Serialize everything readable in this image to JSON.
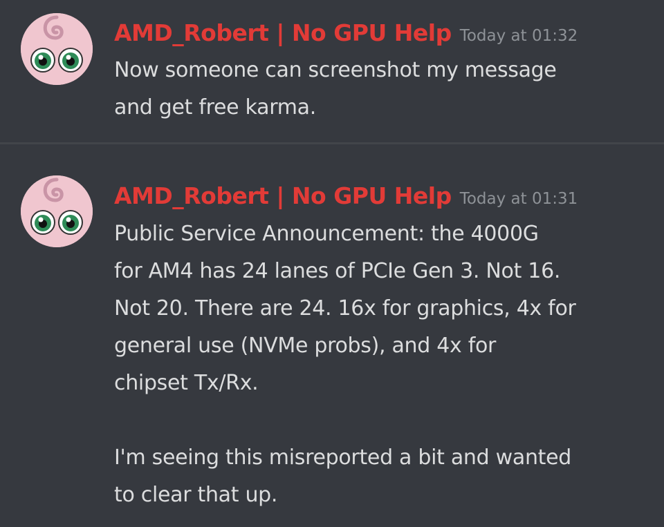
{
  "messages": [
    {
      "username": "AMD_Robert | No GPU Help",
      "timestamp": "Today at 01:32",
      "lines": [
        "Now someone can screenshot my message",
        "and get free karma."
      ]
    },
    {
      "username": "AMD_Robert | No GPU Help",
      "timestamp": "Today at 01:31",
      "lines": [
        "Public Service Announcement: the 4000G",
        "for AM4 has 24 lanes of PCIe Gen 3. Not 16.",
        "Not 20. There are 24. 16x for graphics, 4x for",
        "general use (NVMe probs), and 4x for",
        "chipset Tx/Rx."
      ],
      "lines_2": [
        "I'm seeing this misreported a bit and wanted",
        "to clear that up."
      ]
    }
  ],
  "colors": {
    "background": "#36393f",
    "username": "#e23b37",
    "timestamp": "#8e9297",
    "text": "#dcddde",
    "avatar_bg": "#f0c6cf"
  },
  "icons": {
    "avatar": "jigglypuff-avatar-icon"
  }
}
